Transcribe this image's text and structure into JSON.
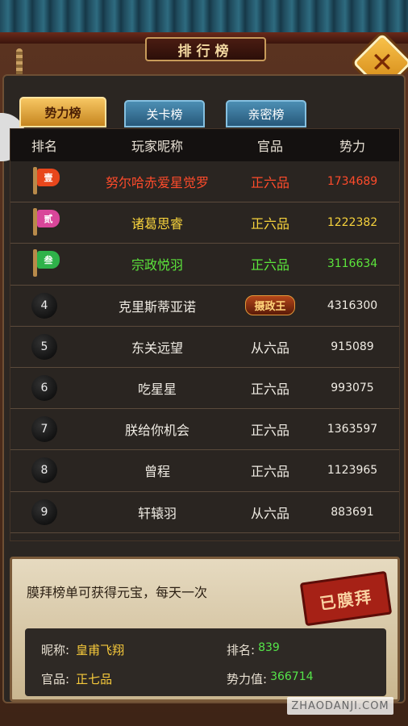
{
  "window": {
    "title": "排行榜"
  },
  "tabs": [
    {
      "label": "势力榜",
      "active": true
    },
    {
      "label": "关卡榜",
      "active": false
    },
    {
      "label": "亲密榜",
      "active": false
    }
  ],
  "table": {
    "headers": {
      "rank": "排名",
      "name": "玩家昵称",
      "title": "官品",
      "power": "势力"
    },
    "rows": [
      {
        "rank": "1",
        "rank_flag": "壹",
        "name": "努尔哈赤爱星觉罗",
        "title": "正六品",
        "power": "1734689",
        "color": "#ff4b2b",
        "flag_color": "#e8471c"
      },
      {
        "rank": "2",
        "rank_flag": "贰",
        "name": "诸葛思睿",
        "title": "正六品",
        "power": "1222382",
        "color": "#f6d23c",
        "flag_color": "#d9469a"
      },
      {
        "rank": "3",
        "rank_flag": "叁",
        "name": "宗政悦羽",
        "title": "正六品",
        "power": "3116634",
        "color": "#5ce63c",
        "flag_color": "#2fb24a"
      },
      {
        "rank": "4",
        "name": "克里斯蒂亚诺",
        "title_badge": "摄政王",
        "power": "4316300",
        "color": "#f0ece4"
      },
      {
        "rank": "5",
        "name": "东关远望",
        "title": "从六品",
        "power": "915089",
        "color": "#f0ece4"
      },
      {
        "rank": "6",
        "name": "吃星星",
        "title": "正六品",
        "power": "993075",
        "color": "#f0ece4"
      },
      {
        "rank": "7",
        "name": "朕给你机会",
        "title": "正六品",
        "power": "1363597",
        "color": "#f0ece4"
      },
      {
        "rank": "8",
        "name": "曾程",
        "title": "正六品",
        "power": "1123965",
        "color": "#f0ece4"
      },
      {
        "rank": "9",
        "name": "轩辕羽",
        "title": "从六品",
        "power": "883691",
        "color": "#f0ece4"
      }
    ]
  },
  "footer": {
    "note": "膜拜榜单可获得元宝，每天一次",
    "stamp": "已膜拜",
    "nickname_label": "昵称:",
    "nickname": "皇甫飞翔",
    "rank_label": "排名:",
    "rank": "839",
    "title_label": "官品:",
    "title": "正七品",
    "power_label": "势力值:",
    "power": "366714"
  },
  "watermark": "ZHAODANJI.COM",
  "icons": {
    "close": "close-icon",
    "side": "chevron-right-icon"
  }
}
